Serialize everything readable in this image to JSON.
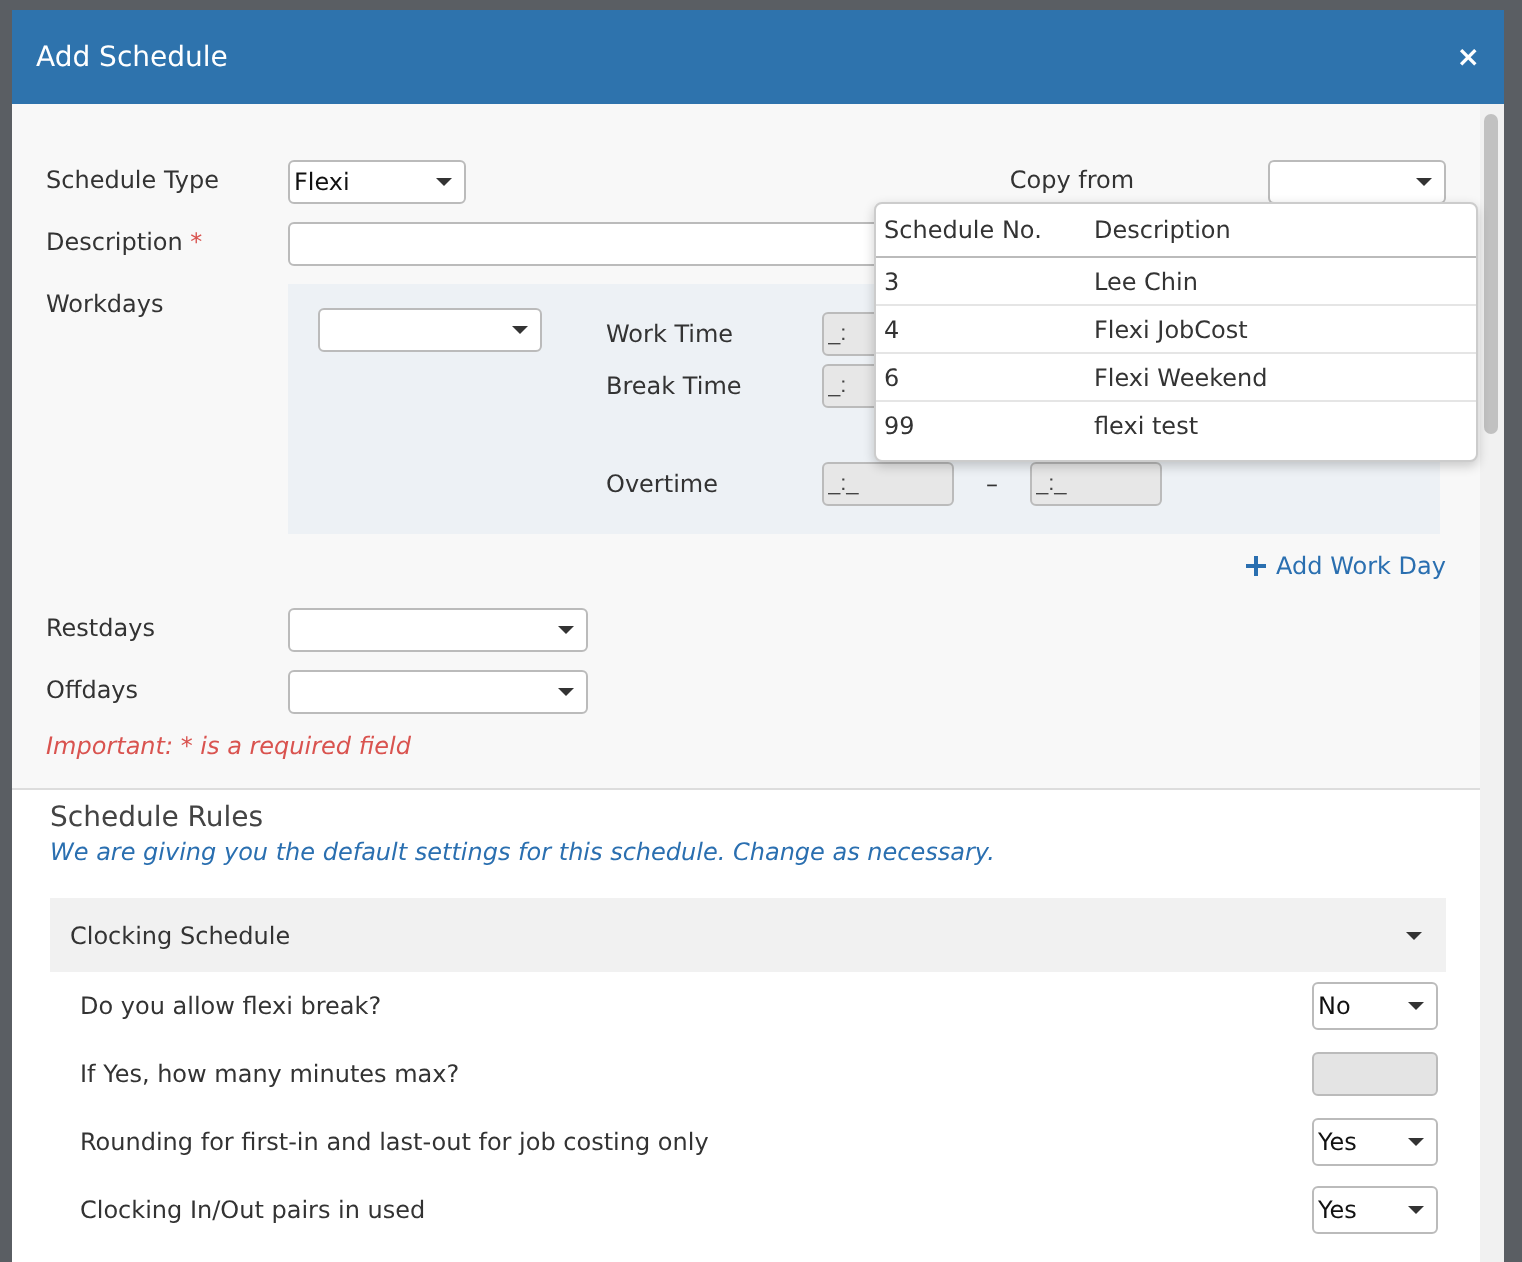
{
  "window": {
    "title": "Add Schedule",
    "close": "×"
  },
  "form": {
    "schedule_type": {
      "label": "Schedule Type",
      "value": "Flexi"
    },
    "copy_from": {
      "label": "Copy from",
      "expanded": true
    },
    "description": {
      "label": "Description",
      "required_mark": "*"
    },
    "workdays": {
      "label": "Workdays",
      "times": [
        {
          "label": "Work Time",
          "fields": [
            {
              "placeholder": "_:"
            }
          ]
        },
        {
          "label": "Break Time",
          "fields": [
            {
              "placeholder": "_:"
            }
          ]
        },
        {
          "label": "Overtime",
          "fields": [
            {
              "placeholder": "_:_"
            },
            {
              "placeholder": "_:_"
            }
          ],
          "separator": "–"
        }
      ]
    },
    "add_work_day": "Add Work Day",
    "restdays": {
      "label": "Restdays"
    },
    "offdays": {
      "label": "Offdays"
    },
    "note": "Important: * is a required field"
  },
  "copy_dropdown": {
    "columns": [
      "Schedule No.",
      "Description"
    ],
    "rows": [
      [
        "3",
        "Lee Chin"
      ],
      [
        "4",
        "Flexi JobCost"
      ],
      [
        "6",
        "Flexi Weekend"
      ],
      [
        "99",
        "flexi test"
      ]
    ]
  },
  "rules": {
    "title": "Schedule Rules",
    "subtitle": "We are giving you the default settings for this schedule. Change as necessary.",
    "section": {
      "title": "Clocking Schedule",
      "expanded": true
    },
    "items": [
      {
        "label": "Do you allow flexi break?",
        "kind": "select",
        "value": "No",
        "disabled": false
      },
      {
        "label": "If Yes, how many minutes max?",
        "kind": "input",
        "value": "",
        "disabled": true
      },
      {
        "label": "Rounding for first-in and last-out for job costing only",
        "kind": "select",
        "value": "Yes",
        "disabled": false
      },
      {
        "label": "Clocking In/Out pairs in used",
        "kind": "select",
        "value": "Yes",
        "disabled": false
      }
    ]
  }
}
